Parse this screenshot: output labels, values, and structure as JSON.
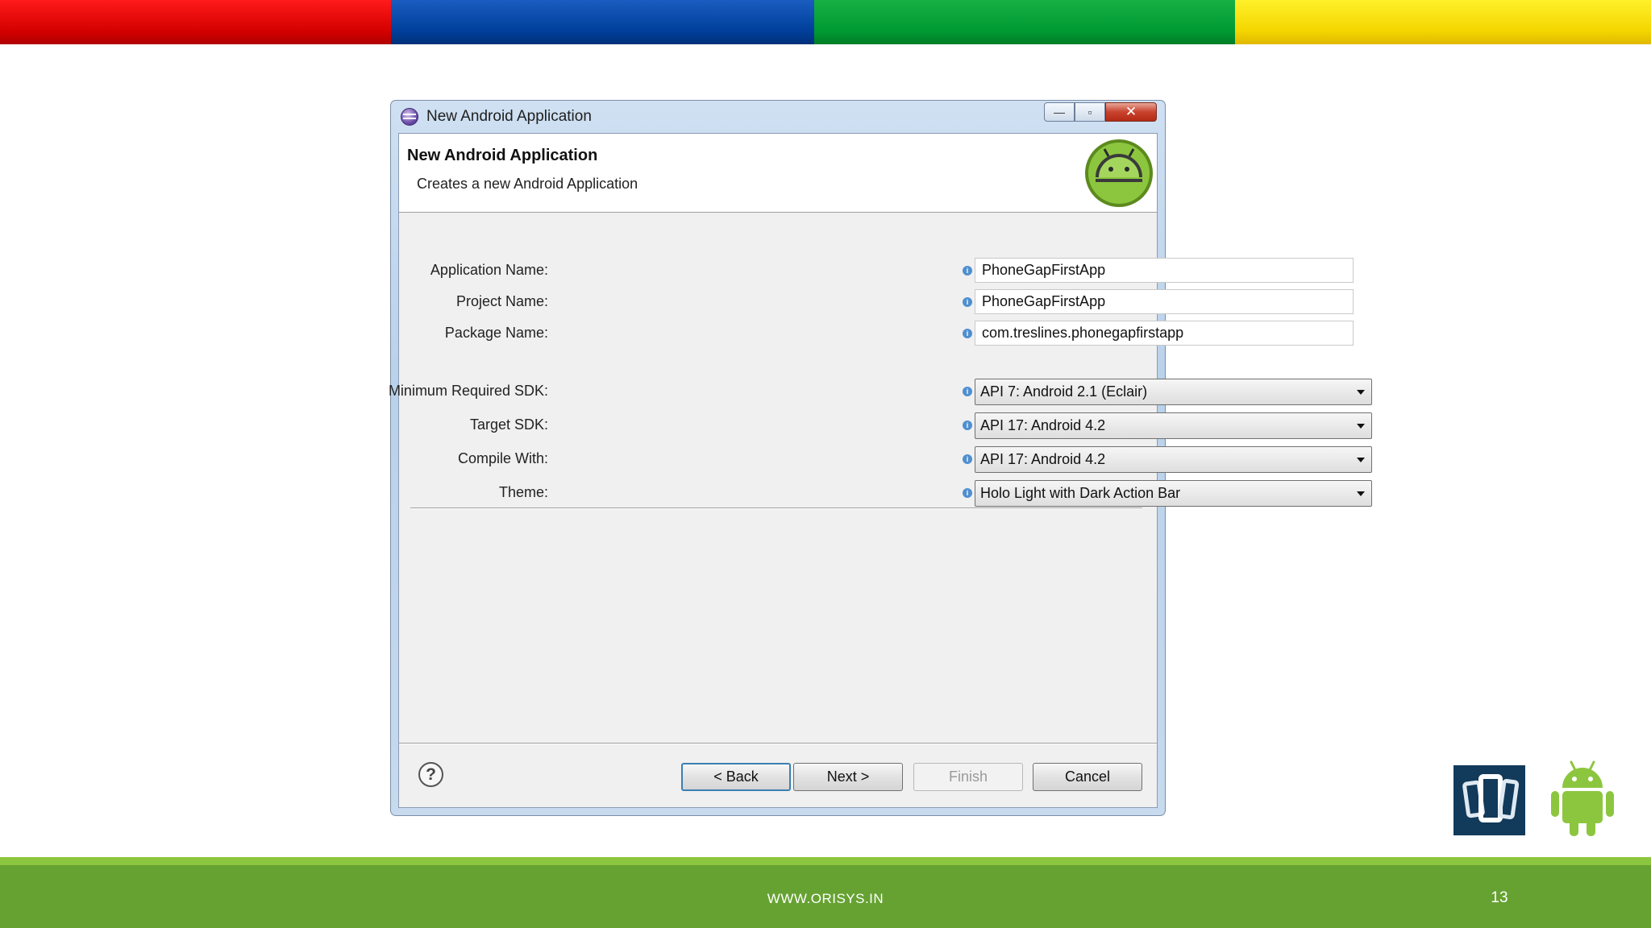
{
  "window": {
    "title": "New Android Application",
    "controls": {
      "minimize": "—",
      "maximize": "▫",
      "close": "✕"
    }
  },
  "banner": {
    "title": "New Android Application",
    "subtitle": "Creates a new Android Application"
  },
  "form": {
    "fields": [
      {
        "label": "Application Name:",
        "value": "PhoneGapFirstApp"
      },
      {
        "label": "Project Name:",
        "value": "PhoneGapFirstApp"
      },
      {
        "label": "Package Name:",
        "value": "com.treslines.phonegapfirstapp"
      }
    ],
    "selects": [
      {
        "label": "Minimum Required SDK:",
        "value": "API 7: Android 2.1 (Eclair)"
      },
      {
        "label": "Target SDK:",
        "value": "API 17: Android 4.2"
      },
      {
        "label": "Compile With:",
        "value": "API 17: Android 4.2"
      },
      {
        "label": "Theme:",
        "value": "Holo Light with Dark Action Bar"
      }
    ],
    "info_glyph": "i"
  },
  "buttons": {
    "help": "?",
    "back": "< Back",
    "next": "Next >",
    "finish": "Finish",
    "cancel": "Cancel"
  },
  "footer": {
    "url": "WWW.ORISYS.IN",
    "page_number": "13"
  },
  "colors": {
    "bar_red": "#e00000",
    "bar_blue": "#003f9a",
    "bar_green": "#009a33",
    "bar_yellow": "#f4d600",
    "footer_green": "#66a232",
    "android_green": "#8cc63f"
  }
}
